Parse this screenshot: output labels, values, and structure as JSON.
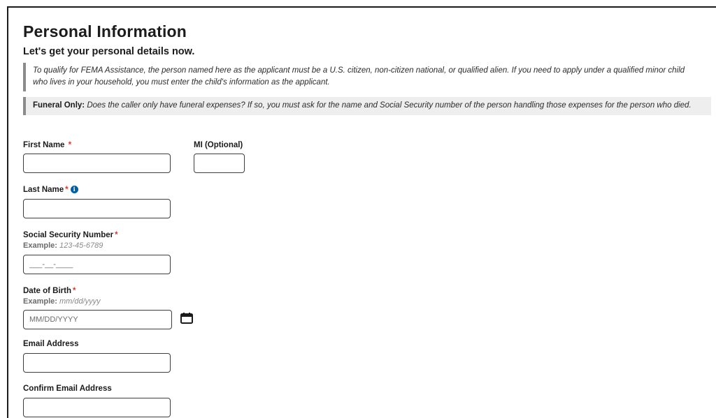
{
  "header": {
    "title": "Personal Information",
    "subtitle": "Let's get your personal details now."
  },
  "note": {
    "text": "To qualify for FEMA Assistance, the person named here as the applicant must be a U.S. citizen, non-citizen national, or qualified alien. If you need to apply under a qualified minor child who lives in your household, you must enter the child's information as the applicant."
  },
  "alert": {
    "bold": "Funeral Only:",
    "text_a": " Does the caller ",
    "text_b": "only",
    "text_c": " have funeral expenses? If so, you must ask for the name and Social Security number of the person handling those expenses for the person who died."
  },
  "form": {
    "required_marker": "*",
    "first_name": {
      "label": "First Name",
      "value": "",
      "placeholder": ""
    },
    "mi": {
      "label": "MI (Optional)",
      "value": "",
      "placeholder": ""
    },
    "last_name": {
      "label": "Last Name",
      "value": "",
      "placeholder": "",
      "info_glyph": "i"
    },
    "ssn": {
      "label": "Social Security Number",
      "example_label": "Example:",
      "example_value": "123-45-6789",
      "placeholder": "___-__-____",
      "value": ""
    },
    "dob": {
      "label": "Date of Birth",
      "example_label": "Example:",
      "example_value": "mm/dd/yyyy",
      "placeholder": "MM/DD/YYYY",
      "value": ""
    },
    "email": {
      "label": "Email Address",
      "value": "",
      "placeholder": ""
    },
    "confirm_email": {
      "label": "Confirm Email Address",
      "value": "",
      "placeholder": ""
    }
  },
  "colors": {
    "required": "#d83933",
    "info": "#005ea2",
    "note_border": "#8b8b8b",
    "alert_bg": "#eeeeee"
  },
  "icons": {
    "info": "info-icon",
    "calendar": "calendar-icon"
  }
}
